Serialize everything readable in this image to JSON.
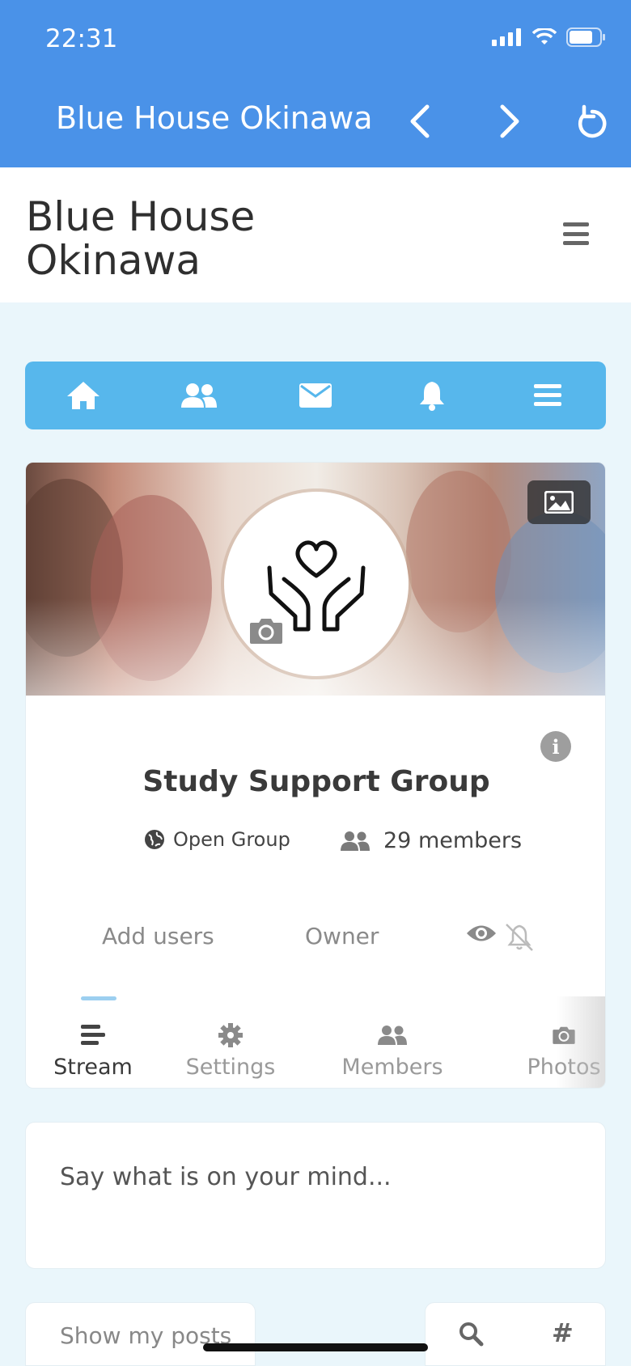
{
  "status": {
    "time": "22:31"
  },
  "navbar": {
    "title": "Blue House Okinawa"
  },
  "site": {
    "title": "Blue House Okinawa"
  },
  "group": {
    "name": "Study Support Group",
    "privacy": "Open Group",
    "members": "29 members",
    "add_users": "Add users",
    "role": "Owner"
  },
  "tabs": [
    {
      "label": "Stream",
      "icon": "stream-icon",
      "active": true
    },
    {
      "label": "Settings",
      "icon": "gear-icon",
      "active": false
    },
    {
      "label": "Members",
      "icon": "users-icon",
      "active": false
    },
    {
      "label": "Photos",
      "icon": "camera-icon",
      "active": false
    }
  ],
  "composer": {
    "placeholder": "Say what is on your mind..."
  },
  "filters": {
    "show_my_posts": "Show my posts",
    "hashtag": "#"
  },
  "colors": {
    "header_blue": "#4a92e8",
    "iconbar_blue": "#57b7ec",
    "page_bg": "#eaf6fb"
  }
}
